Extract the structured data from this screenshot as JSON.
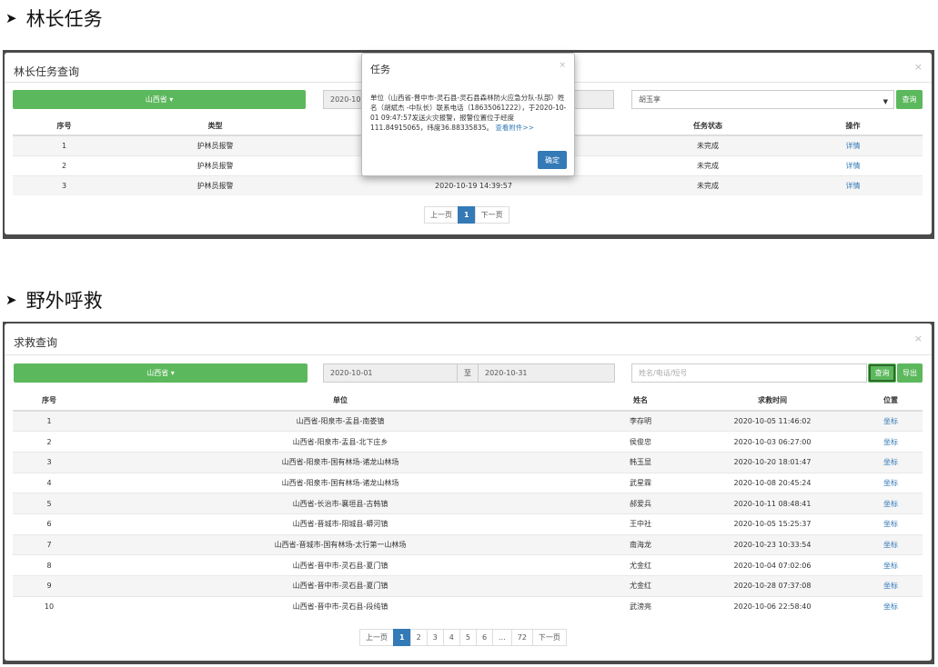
{
  "section1": {
    "heading": "林长任务",
    "panel_title": "林长任务查询",
    "province_select": "山西省 ▾",
    "date_start": "2020-10",
    "name_select": "胡玉享",
    "search_label": "查询",
    "columns": [
      "序号",
      "类型",
      "",
      "任务状态",
      "操作"
    ],
    "rows": [
      {
        "no": "1",
        "type": "护林员报警",
        "time": "",
        "status": "未完成",
        "action": "详情"
      },
      {
        "no": "2",
        "type": "护林员报警",
        "time": "",
        "status": "未完成",
        "action": "详情"
      },
      {
        "no": "3",
        "type": "护林员报警",
        "time": "2020-10-19 14:39:57",
        "status": "未完成",
        "action": "详情"
      }
    ],
    "pager": {
      "prev": "上一页",
      "current": "1",
      "next": "下一页"
    }
  },
  "dialog": {
    "title": "任务",
    "close": "×",
    "body": "单位（山西省-晋中市-灵石县-灵石县森林防火应急分队-队部）姓名（胡斌杰 -中队长）联系电话（18635061222），于2020-10-01 09:47:57发送火灾报警，报警位置位于经度111.84915065，纬度36.88335835。",
    "attachment_link": "查看附件>>",
    "ok_label": "确定"
  },
  "section2": {
    "heading": "野外呼救",
    "panel_title": "求救查询",
    "province_select": "山西省 ▾",
    "date_start": "2020-10-01",
    "date_sep": "至",
    "date_end": "2020-10-31",
    "search_placeholder": "姓名/电话/短号",
    "search_label": "查询",
    "export_label": "导出",
    "columns": [
      "序号",
      "单位",
      "姓名",
      "求救时间",
      "位置"
    ],
    "rows": [
      {
        "no": "1",
        "unit": "山西省-阳泉市-盂县-南娄镇",
        "name": "李存明",
        "time": "2020-10-05 11:46:02",
        "loc": "坐标"
      },
      {
        "no": "2",
        "unit": "山西省-阳泉市-盂县-北下庄乡",
        "name": "侯俊忠",
        "time": "2020-10-03 06:27:00",
        "loc": "坐标"
      },
      {
        "no": "3",
        "unit": "山西省-阳泉市-国有林场-诸龙山林场",
        "name": "韩玉显",
        "time": "2020-10-20 18:01:47",
        "loc": "坐标"
      },
      {
        "no": "4",
        "unit": "山西省-阳泉市-国有林场-诸龙山林场",
        "name": "武星霖",
        "time": "2020-10-08 20:45:24",
        "loc": "坐标"
      },
      {
        "no": "5",
        "unit": "山西省-长治市-襄垣县-古韩镇",
        "name": "郝爱兵",
        "time": "2020-10-11 08:48:41",
        "loc": "坐标"
      },
      {
        "no": "6",
        "unit": "山西省-晋城市-阳城县-蟒河镇",
        "name": "王中社",
        "time": "2020-10-05 15:25:37",
        "loc": "坐标"
      },
      {
        "no": "7",
        "unit": "山西省-晋城市-国有林场-太行第一山林场",
        "name": "南海龙",
        "time": "2020-10-23 10:33:54",
        "loc": "坐标"
      },
      {
        "no": "8",
        "unit": "山西省-晋中市-灵石县-夏门镇",
        "name": "尤金红",
        "time": "2020-10-04 07:02:06",
        "loc": "坐标"
      },
      {
        "no": "9",
        "unit": "山西省-晋中市-灵石县-夏门镇",
        "name": "尤金红",
        "time": "2020-10-28 07:37:08",
        "loc": "坐标"
      },
      {
        "no": "10",
        "unit": "山西省-晋中市-灵石县-段纯镇",
        "name": "武滂亮",
        "time": "2020-10-06 22:58:40",
        "loc": "坐标"
      }
    ],
    "pager": [
      "上一页",
      "1",
      "2",
      "3",
      "4",
      "5",
      "6",
      "...",
      "72",
      "下一页"
    ],
    "pager_current": "1"
  },
  "colors": {
    "green": "#5cb85c",
    "blue": "#337ab7",
    "backdrop": "#4a4a4a"
  }
}
